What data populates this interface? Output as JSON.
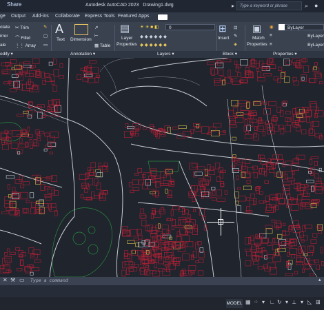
{
  "titlebar": {
    "share_label": "Share",
    "app_title": "Autodesk AutoCAD 2023",
    "drawing_name": "Drawing1.dwg",
    "search_placeholder": "Type a keyword or phrase"
  },
  "tabs": [
    "ge",
    "Output",
    "Add-ins",
    "Collaborate",
    "Express Tools",
    "Featured Apps"
  ],
  "ribbon": {
    "modify": {
      "items": [
        "otate",
        "Trim",
        "irror",
        "Fillet",
        "ale",
        "Array"
      ],
      "panel": "odify"
    },
    "annotation": {
      "items": [
        "Text",
        "Dimension",
        "Table"
      ],
      "panel": "Annotation"
    },
    "layers": {
      "layer_props": [
        "Layer",
        "Properties"
      ],
      "layer_value": "0",
      "panel": "Layers"
    },
    "block": {
      "items": [
        "Insert"
      ],
      "panel": "Block"
    },
    "properties": {
      "match": [
        "Match",
        "Properties"
      ],
      "bylayer": [
        "ByLayer",
        "ByLayer",
        "ByLayer"
      ],
      "panel": "Properties"
    }
  },
  "command": {
    "placeholder": "Type a command"
  },
  "status": {
    "model": "MODEL"
  },
  "icons": [
    "search-icon",
    "user-icon",
    "close-icon",
    "wrench-icon",
    "grid-icon",
    "snap-icon",
    "ortho-icon",
    "polar-icon"
  ],
  "colors": {
    "titlebar": "#202733",
    "ribbon": "#3a4250",
    "canvas": "#1f242d",
    "building": "#b22035",
    "road": "#c8ccd2",
    "vegetation": "#2b8a3e"
  }
}
